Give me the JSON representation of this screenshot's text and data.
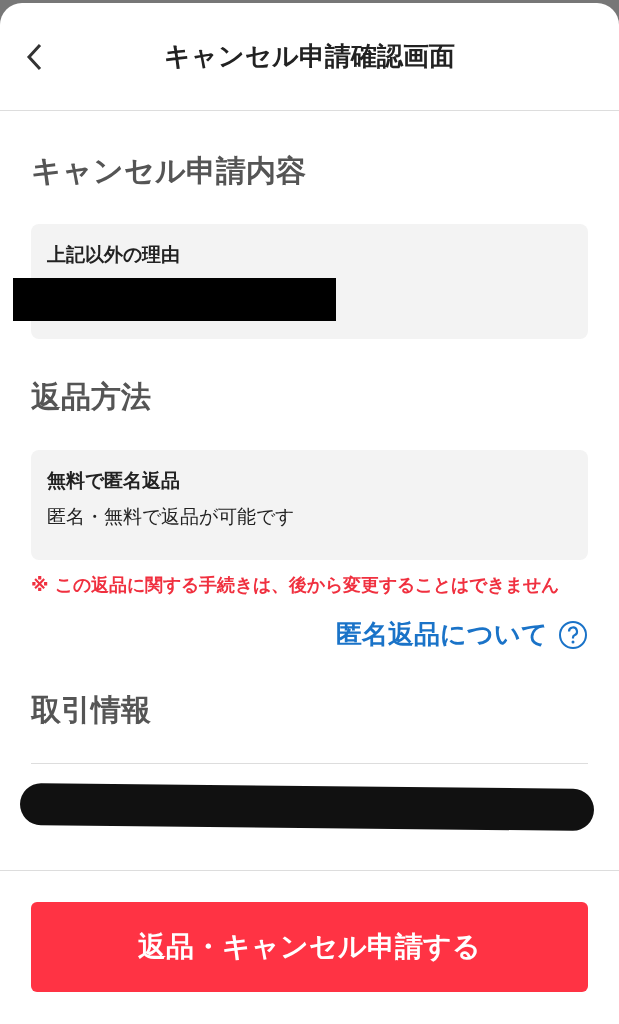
{
  "header": {
    "title": "キャンセル申請確認画面"
  },
  "sections": [
    {
      "title": "キャンセル申請内容",
      "card": {
        "heading": "上記以外の理由",
        "redacted": true
      }
    },
    {
      "title": "返品方法",
      "card": {
        "heading": "無料で匿名返品",
        "body": "匿名・無料で返品が可能です"
      },
      "note": "※ この返品に関する手続きは、後から変更することはできません",
      "link": "匿名返品について"
    },
    {
      "title": "取引情報",
      "redacted": true
    }
  ],
  "submit": {
    "label": "返品・キャンセル申請する"
  }
}
